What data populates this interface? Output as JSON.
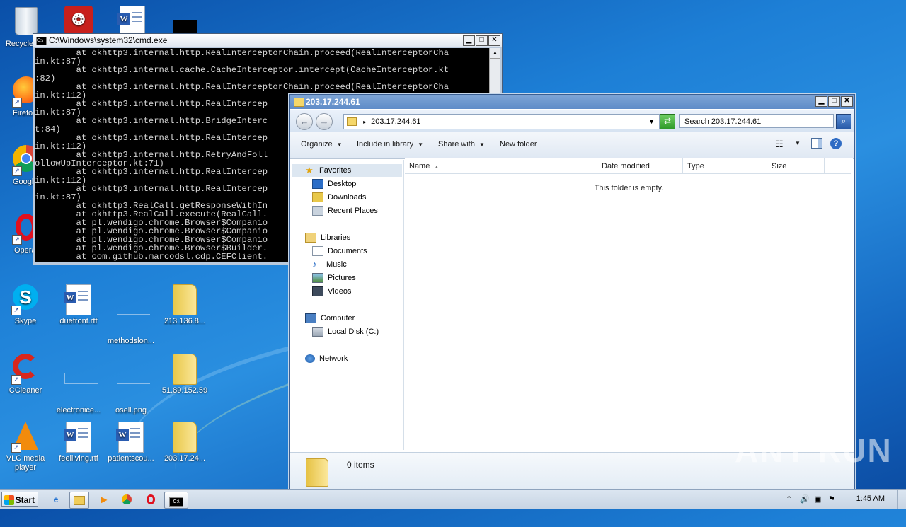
{
  "desktop": {
    "icons": [
      {
        "label": "Recycle Bin",
        "kind": "recycle"
      },
      {
        "label": "Acrobat Reader DC",
        "kind": "pdf"
      },
      {
        "label": "",
        "kind": "word"
      },
      {
        "label": "",
        "kind": "black"
      },
      {
        "label": "Firefox",
        "kind": "firefox"
      },
      {
        "label": "Google Chrome",
        "kind": "chrome"
      },
      {
        "label": "Opera",
        "kind": "opera"
      },
      {
        "label": "Skype",
        "kind": "skype"
      },
      {
        "label": "duefront.rtf",
        "kind": "word"
      },
      {
        "label": "methodslon...",
        "kind": "blank"
      },
      {
        "label": "213.136.8...",
        "kind": "folder"
      },
      {
        "label": "CCleaner",
        "kind": "ccleaner"
      },
      {
        "label": "electronice...",
        "kind": "blank"
      },
      {
        "label": "osell.png",
        "kind": "blank"
      },
      {
        "label": "51.89.152.59",
        "kind": "folder"
      },
      {
        "label": "VLC media player",
        "kind": "vlc"
      },
      {
        "label": "feelliving.rtf",
        "kind": "word"
      },
      {
        "label": "patientscou...",
        "kind": "word"
      },
      {
        "label": "203.17.24...",
        "kind": "folder"
      }
    ]
  },
  "cmd": {
    "title": "C:\\Windows\\system32\\cmd.exe",
    "lines": [
      "        at okhttp3.internal.http.RealInterceptorChain.proceed(RealInterceptorCha",
      "in.kt:87)",
      "        at okhttp3.internal.cache.CacheInterceptor.intercept(CacheInterceptor.kt",
      ":82)",
      "        at okhttp3.internal.http.RealInterceptorChain.proceed(RealInterceptorCha",
      "in.kt:112)",
      "        at okhttp3.internal.http.RealIntercep",
      "in.kt:87)",
      "        at okhttp3.internal.http.BridgeInterc",
      "t:84)",
      "        at okhttp3.internal.http.RealIntercep",
      "in.kt:112)",
      "        at okhttp3.internal.http.RetryAndFoll",
      "ollowUpInterceptor.kt:71)",
      "        at okhttp3.internal.http.RealIntercep",
      "in.kt:112)",
      "        at okhttp3.internal.http.RealIntercep",
      "in.kt:87)",
      "        at okhttp3.RealCall.getResponseWithIn",
      "        at okhttp3.RealCall.execute(RealCall.",
      "        at pl.wendigo.chrome.Browser$Companio",
      "        at pl.wendigo.chrome.Browser$Companio",
      "        at pl.wendigo.chrome.Browser$Companio",
      "        at pl.wendigo.chrome.Browser$Builder.",
      "        at com.github.marcodsl.cdp.CEFClient."
    ]
  },
  "explorer": {
    "title": "203.17.244.61",
    "address": "203.17.244.61",
    "search_placeholder": "Search 203.17.244.61",
    "toolbar": {
      "organize": "Organize",
      "include": "Include in library",
      "share": "Share with",
      "new_folder": "New folder"
    },
    "nav": {
      "favorites": "Favorites",
      "desktop": "Desktop",
      "downloads": "Downloads",
      "recent": "Recent Places",
      "libraries": "Libraries",
      "documents": "Documents",
      "music": "Music",
      "pictures": "Pictures",
      "videos": "Videos",
      "computer": "Computer",
      "local_disk": "Local Disk (C:)",
      "network": "Network"
    },
    "columns": {
      "name": "Name",
      "date": "Date modified",
      "type": "Type",
      "size": "Size"
    },
    "empty_message": "This folder is empty.",
    "item_count": "0 items"
  },
  "taskbar": {
    "start": "Start",
    "clock": "1:45 AM"
  },
  "watermark": "ANY RUN"
}
